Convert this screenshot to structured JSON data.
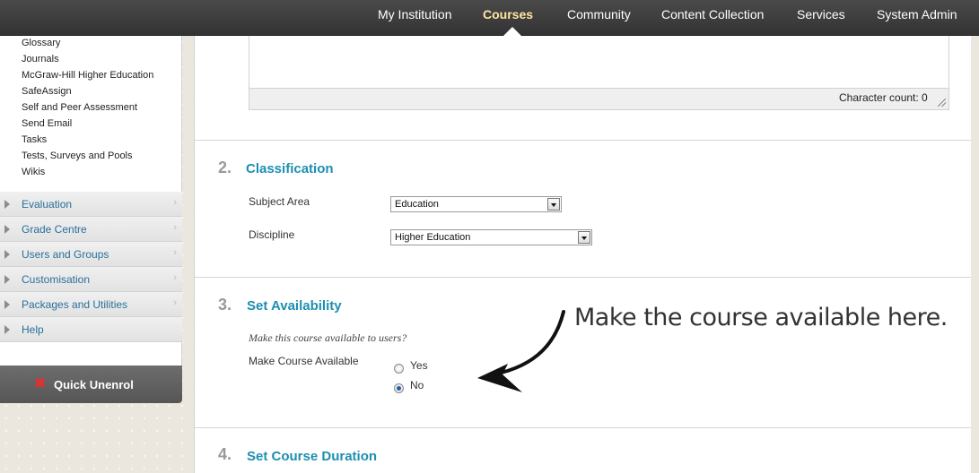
{
  "nav": {
    "items": [
      "My Institution",
      "Courses",
      "Community",
      "Content Collection",
      "Services",
      "System Admin"
    ],
    "active": "Courses"
  },
  "sidebar": {
    "tools": [
      "Glossary",
      "Journals",
      "McGraw-Hill Higher Education",
      "SafeAssign",
      "Self and Peer Assessment",
      "Send Email",
      "Tasks",
      "Tests, Surveys and Pools",
      "Wikis"
    ],
    "sections": [
      "Evaluation",
      "Grade Centre",
      "Users and Groups",
      "Customisation",
      "Packages and Utilities",
      "Help"
    ],
    "quick_unenrol": "Quick Unenrol"
  },
  "textarea": {
    "char_count": "Character count: 0"
  },
  "classification": {
    "num": "2.",
    "title": "Classification",
    "subject_label": "Subject Area",
    "subject_value": "Education",
    "discipline_label": "Discipline",
    "discipline_value": "Higher Education"
  },
  "availability": {
    "num": "3.",
    "title": "Set Availability",
    "instruction": "Make this course available to users?",
    "label": "Make Course Available",
    "yes": "Yes",
    "no": "No",
    "selected": "No"
  },
  "duration": {
    "num": "4.",
    "title": "Set Course Duration"
  },
  "annotation": "Make the course available here.",
  "colors": {
    "accent": "#1d8fb0",
    "nav_active": "#ffe7a0",
    "sidebar_link": "#2a6f9a"
  }
}
